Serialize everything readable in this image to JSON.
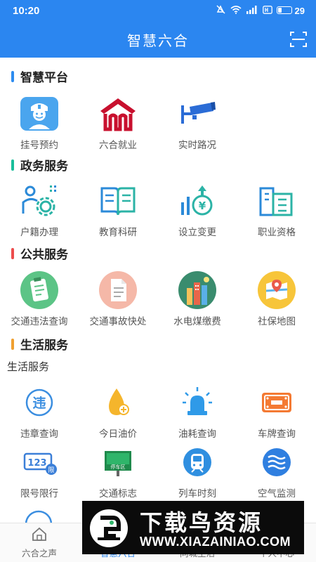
{
  "status_bar": {
    "time": "10:20",
    "battery": "29"
  },
  "header": {
    "title": "智慧六合"
  },
  "sections": {
    "smart_platform": {
      "title": "智慧平台",
      "color": "#2d8cf0",
      "items": [
        {
          "label": "挂号预约",
          "icon": "doctor-icon"
        },
        {
          "label": "六合就业",
          "icon": "house-logo-icon"
        },
        {
          "label": "实时路况",
          "icon": "camera-icon"
        }
      ]
    },
    "gov_services": {
      "title": "政务服务",
      "color": "#19be9b",
      "items": [
        {
          "label": "户籍办理",
          "icon": "person-gear-icon"
        },
        {
          "label": "教育科研",
          "icon": "book-icon"
        },
        {
          "label": "设立变更",
          "icon": "finance-icon"
        },
        {
          "label": "职业资格",
          "icon": "building-icon"
        }
      ]
    },
    "public_services": {
      "title": "公共服务",
      "color": "#ed4d4d",
      "items": [
        {
          "label": "交通违法查询",
          "icon": "clipboard-icon"
        },
        {
          "label": "交通事故快处",
          "icon": "document-icon"
        },
        {
          "label": "水电煤缴费",
          "icon": "city-icon"
        },
        {
          "label": "社保地图",
          "icon": "map-icon"
        }
      ]
    },
    "life_services": {
      "title": "生活服务",
      "color": "#f0a030",
      "subtitle": "生活服务",
      "items": [
        {
          "label": "违章查询",
          "icon": "violation-icon"
        },
        {
          "label": "今日油价",
          "icon": "oil-drop-icon"
        },
        {
          "label": "油耗查询",
          "icon": "alarm-light-icon"
        },
        {
          "label": "车牌查询",
          "icon": "license-plate-icon"
        },
        {
          "label": "限号限行",
          "icon": "limit-plate-icon"
        },
        {
          "label": "交通标志",
          "icon": "parking-sign-icon"
        },
        {
          "label": "列车时刻",
          "icon": "train-icon"
        },
        {
          "label": "空气监测",
          "icon": "air-wave-icon"
        }
      ]
    }
  },
  "bottom_nav": [
    {
      "label": "六合之声",
      "icon": "home-icon"
    },
    {
      "label": "智慧六合",
      "icon": "smart-icon"
    },
    {
      "label": "同城生活",
      "icon": "city-life-icon"
    },
    {
      "label": "个人中心",
      "icon": "person-icon"
    }
  ],
  "watermark": {
    "title": "下载鸟资源",
    "url": "WWW.XIAZAINIAO.COM"
  }
}
